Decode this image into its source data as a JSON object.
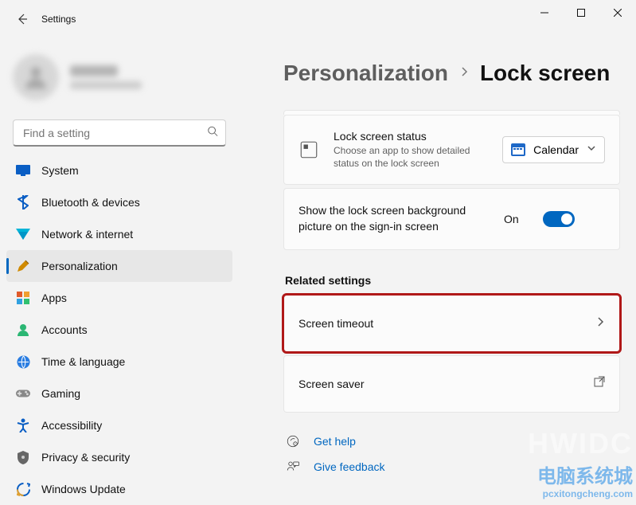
{
  "window": {
    "title": "Settings"
  },
  "search": {
    "placeholder": "Find a setting"
  },
  "nav": {
    "items": [
      {
        "key": "system",
        "label": "System",
        "color": "#0a5ec4"
      },
      {
        "key": "bluetooth",
        "label": "Bluetooth & devices",
        "color": "#0a5ec4"
      },
      {
        "key": "network",
        "label": "Network & internet",
        "color": "#00a3e0"
      },
      {
        "key": "personalization",
        "label": "Personalization",
        "color": "#d08a00"
      },
      {
        "key": "apps",
        "label": "Apps",
        "color": "#e05a2b"
      },
      {
        "key": "accounts",
        "label": "Accounts",
        "color": "#2bb673"
      },
      {
        "key": "time",
        "label": "Time & language",
        "color": "#2a7de1"
      },
      {
        "key": "gaming",
        "label": "Gaming",
        "color": "#888"
      },
      {
        "key": "accessibility",
        "label": "Accessibility",
        "color": "#0a5ec4"
      },
      {
        "key": "privacy",
        "label": "Privacy & security",
        "color": "#666"
      },
      {
        "key": "update",
        "label": "Windows Update",
        "color": "#0a5ec4"
      }
    ],
    "selected": "personalization"
  },
  "breadcrumb": {
    "prev": "Personalization",
    "current": "Lock screen"
  },
  "lockstatus": {
    "title": "Lock screen status",
    "desc": "Choose an app to show detailed status on the lock screen",
    "dropdown": {
      "label": "Calendar",
      "iconColor": "#1e68c7"
    }
  },
  "bgToggle": {
    "text": "Show the lock screen background picture on the sign-in screen",
    "state": "On",
    "on": true
  },
  "related": {
    "title": "Related settings",
    "items": [
      {
        "key": "timeout",
        "label": "Screen timeout",
        "highlighted": true,
        "external": false
      },
      {
        "key": "saver",
        "label": "Screen saver",
        "highlighted": false,
        "external": true
      }
    ]
  },
  "help": {
    "gethelp": "Get help",
    "feedback": "Give feedback"
  },
  "watermark": {
    "l1": "HWIDC",
    "l2": "电脑系统城",
    "l3": "pcxitongcheng.com"
  }
}
